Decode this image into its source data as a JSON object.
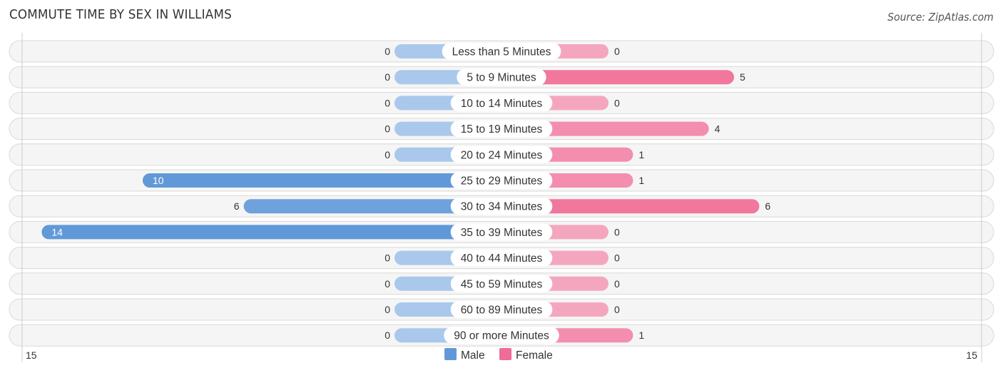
{
  "title": "COMMUTE TIME BY SEX IN WILLIAMS",
  "source": "Source: ZipAtlas.com",
  "chart_data": {
    "type": "bar",
    "orientation": "horizontal-diverging",
    "title": "COMMUTE TIME BY SEX IN WILLIAMS",
    "categories": [
      "Less than 5 Minutes",
      "5 to 9 Minutes",
      "10 to 14 Minutes",
      "15 to 19 Minutes",
      "20 to 24 Minutes",
      "25 to 29 Minutes",
      "30 to 34 Minutes",
      "35 to 39 Minutes",
      "40 to 44 Minutes",
      "45 to 59 Minutes",
      "60 to 89 Minutes",
      "90 or more Minutes"
    ],
    "series": [
      {
        "name": "Male",
        "color": "#6199d8",
        "light_color": "#a9c8ec",
        "values": [
          0,
          0,
          0,
          0,
          0,
          10,
          6,
          14,
          0,
          0,
          0,
          0
        ]
      },
      {
        "name": "Female",
        "color": "#f06b95",
        "light_color": "#f5a6bf",
        "values": [
          0,
          5,
          0,
          4,
          1,
          1,
          6,
          0,
          0,
          0,
          0,
          1
        ]
      }
    ],
    "axis": {
      "left_label": "15",
      "right_label": "15",
      "max": 15
    },
    "legend": {
      "position": "bottom-center",
      "items": [
        "Male",
        "Female"
      ]
    }
  }
}
